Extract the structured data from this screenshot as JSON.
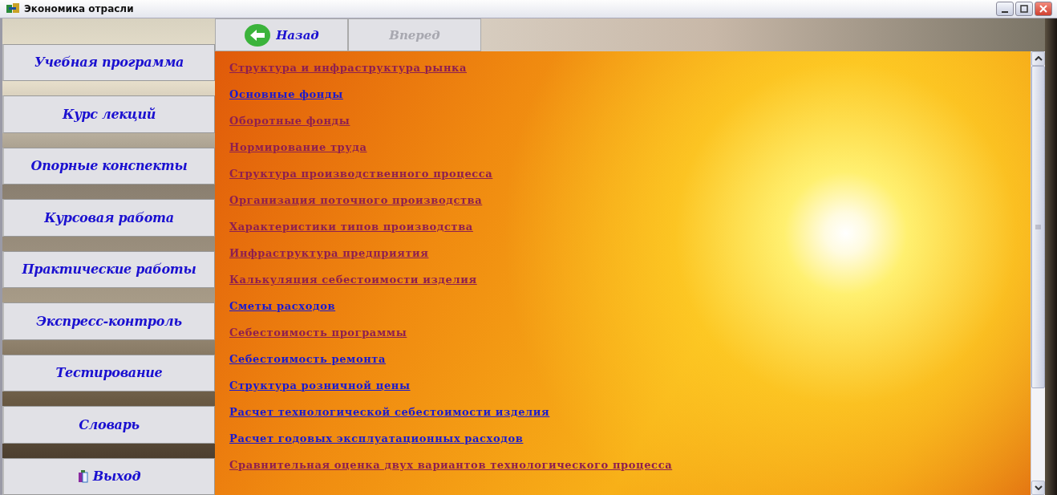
{
  "window": {
    "title": "Экономика отрасли"
  },
  "toolbar": [
    {
      "label": "Назад",
      "kind": "back",
      "disabled": false
    },
    {
      "label": "Вперед",
      "kind": "forward",
      "disabled": true
    }
  ],
  "sidebar": {
    "items": [
      {
        "label": "Учебная программа",
        "kind": "plain"
      },
      {
        "label": "Курс лекций",
        "kind": "plain"
      },
      {
        "label": "Опорные конспекты",
        "kind": "plain"
      },
      {
        "label": "Курсовая работа",
        "kind": "plain"
      },
      {
        "label": "Практические работы",
        "kind": "plain"
      },
      {
        "label": "Экспресс-контроль",
        "kind": "plain"
      },
      {
        "label": "Тестирование",
        "kind": "plain"
      },
      {
        "label": "Словарь",
        "kind": "plain"
      },
      {
        "label": "Выход",
        "kind": "exit"
      }
    ]
  },
  "links": [
    {
      "label": "Структура и инфраструктура рынка",
      "visited": true
    },
    {
      "label": "Основные фонды",
      "visited": false
    },
    {
      "label": "Оборотные фонды",
      "visited": true
    },
    {
      "label": "Нормирование труда",
      "visited": true
    },
    {
      "label": "Структура производственного процесса",
      "visited": true
    },
    {
      "label": "Организация поточного производства",
      "visited": true
    },
    {
      "label": "Характеристики типов производства",
      "visited": true
    },
    {
      "label": "Инфраструктура предприятия",
      "visited": true
    },
    {
      "label": "Калькуляция себестоимости изделия",
      "visited": true
    },
    {
      "label": "Сметы расходов",
      "visited": false
    },
    {
      "label": "Себестоимость программы",
      "visited": true
    },
    {
      "label": "Себестоимость ремонта",
      "visited": false
    },
    {
      "label": "Структура розничной цены",
      "visited": false
    },
    {
      "label": "Расчет технологической себестоимости изделия",
      "visited": false
    },
    {
      "label": "Расчет годовых эксплуатационных расходов",
      "visited": false
    },
    {
      "label": "Сравнительная оценка двух вариантов технологического процесса",
      "visited": true
    }
  ]
}
